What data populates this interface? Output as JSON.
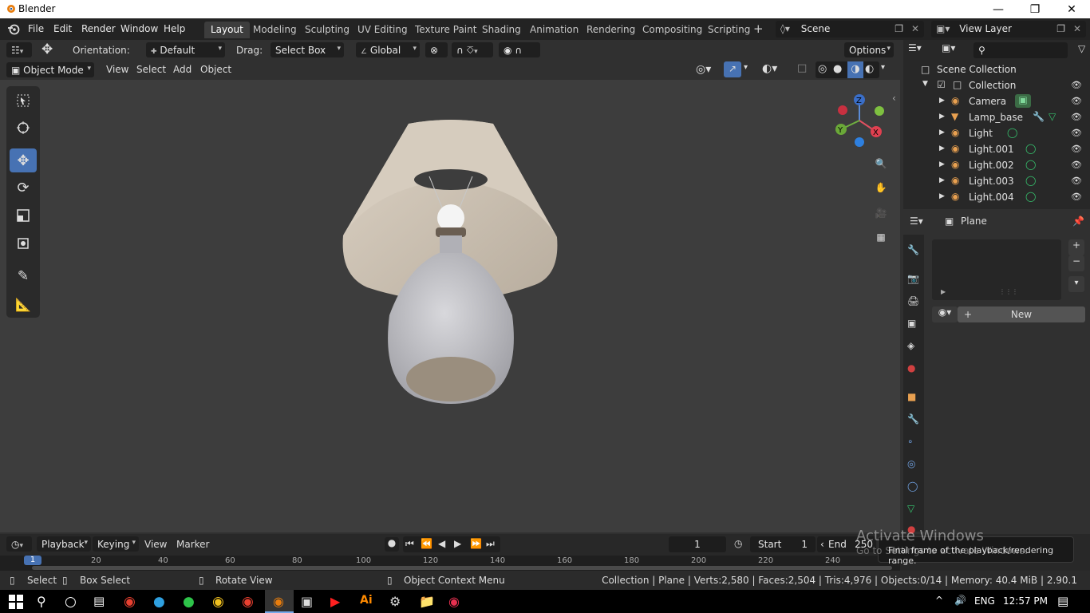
{
  "window": {
    "title": "Blender"
  },
  "menu": [
    "File",
    "Edit",
    "Render",
    "Window",
    "Help"
  ],
  "workspaces": [
    "Layout",
    "Modeling",
    "Sculpting",
    "UV Editing",
    "Texture Paint",
    "Shading",
    "Animation",
    "Rendering",
    "Compositing",
    "Scripting"
  ],
  "active_workspace": "Layout",
  "scene": {
    "label": "Scene",
    "view_layer": "View Layer"
  },
  "header_tools": {
    "orientation_label": "Orientation:",
    "orientation_value": "Default",
    "drag_label": "Drag:",
    "drag_value": "Select Box",
    "transform_value": "Global",
    "options": "Options"
  },
  "viewport_header": {
    "mode": "Object Mode",
    "menus": [
      "View",
      "Select",
      "Add",
      "Object"
    ]
  },
  "gizmo": {
    "axes": [
      "Z",
      "Y",
      "X"
    ]
  },
  "outliner": {
    "root": "Scene Collection",
    "collection": "Collection",
    "items": [
      {
        "name": "Camera"
      },
      {
        "name": "Lamp_base"
      },
      {
        "name": "Light"
      },
      {
        "name": "Light.001"
      },
      {
        "name": "Light.002"
      },
      {
        "name": "Light.003"
      },
      {
        "name": "Light.004"
      }
    ]
  },
  "properties": {
    "object_name": "Plane",
    "new_button": "New"
  },
  "timeline": {
    "menus": [
      "Playback",
      "Keying",
      "View",
      "Marker"
    ],
    "current_frame": "1",
    "start_label": "Start",
    "start_value": "1",
    "end_label": "End",
    "end_value": "250",
    "ruler": [
      "1",
      "20",
      "40",
      "60",
      "80",
      "100",
      "120",
      "140",
      "160",
      "180",
      "200",
      "220",
      "240"
    ],
    "tooltip": "Final frame of the playback/rendering range."
  },
  "watermark": {
    "line1": "Activate Windows",
    "line2": "Go to Settings to activate Windows."
  },
  "statusbar": {
    "select": "Select",
    "box_select": "Box Select",
    "rotate_view": "Rotate View",
    "context_menu": "Object Context Menu",
    "stats": "Collection | Plane | Verts:2,580 | Faces:2,504 | Tris:4,976 | Objects:0/14 | Memory: 40.4 MiB | 2.90.1"
  },
  "taskbar": {
    "lang": "ENG",
    "time": "12:57 PM"
  },
  "colors": {
    "accent": "#4772b3",
    "orange": "#e8a050",
    "green": "#36c46e"
  }
}
